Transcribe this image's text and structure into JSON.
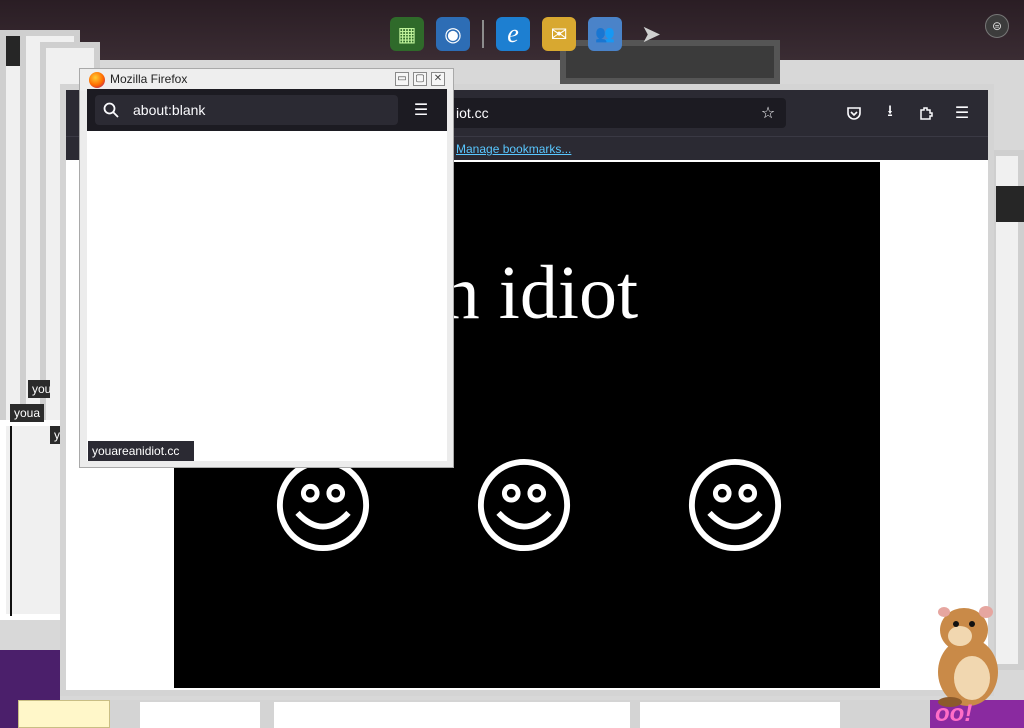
{
  "background": {
    "ghost_labels": [
      "youa",
      "you",
      "youa",
      "y"
    ],
    "corner_text": "oo!"
  },
  "dock": {
    "items": [
      {
        "name": "app-grid-icon",
        "glyph": "▦",
        "bg": "#2f6a2a"
      },
      {
        "name": "download-globe-icon",
        "glyph": "◉",
        "bg": "#2d6db5"
      },
      {
        "name": "ie-icon",
        "glyph": "e",
        "bg": "#1d7fd1"
      },
      {
        "name": "mail-icon",
        "glyph": "✉",
        "bg": "#d8a830"
      },
      {
        "name": "people-icon",
        "glyph": "👥",
        "bg": "#4a83c9"
      }
    ]
  },
  "main_browser": {
    "url": "iot.cc",
    "bookmarks_link": "Manage bookmarks...",
    "headline": "re an idiot"
  },
  "small_firefox": {
    "title": "Mozilla Firefox",
    "url": "about:blank",
    "status": "youareanidiot.cc"
  },
  "colors": {
    "toolbar_dark": "#2b2a33",
    "link": "#59c7ff",
    "video_bg": "#000000"
  }
}
